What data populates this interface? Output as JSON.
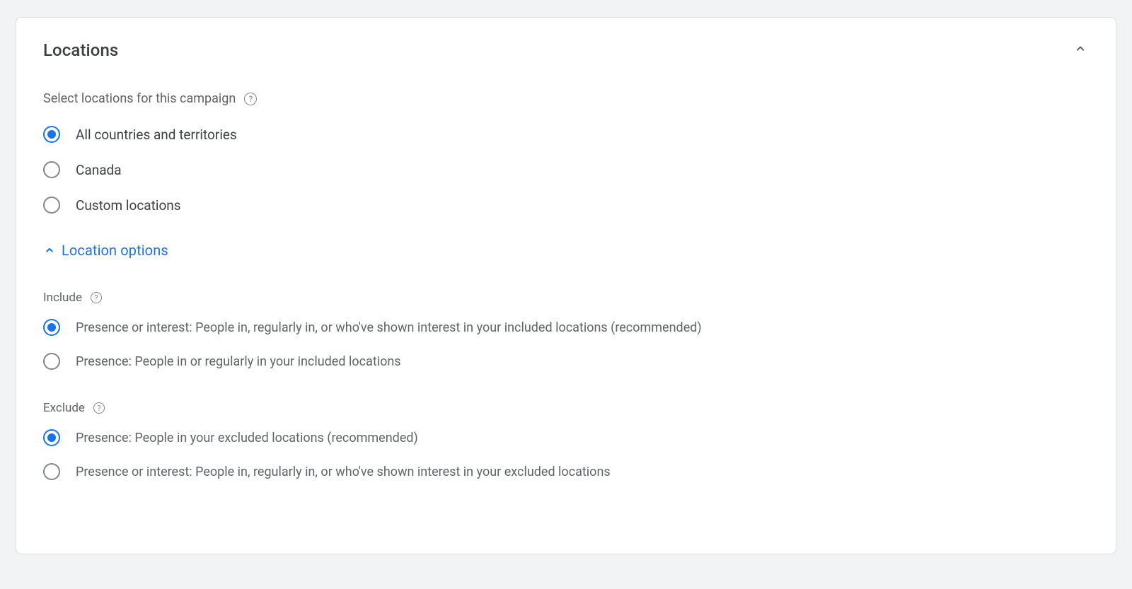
{
  "panel": {
    "title": "Locations",
    "subtitle": "Select locations for this campaign"
  },
  "locations": {
    "options": [
      {
        "label": "All countries and territories",
        "selected": true
      },
      {
        "label": "Canada",
        "selected": false
      },
      {
        "label": "Custom locations",
        "selected": false
      }
    ]
  },
  "expand": {
    "label": "Location options"
  },
  "include": {
    "label": "Include",
    "options": [
      {
        "label": "Presence or interest: People in, regularly in, or who've shown interest in your included locations (recommended)",
        "selected": true
      },
      {
        "label": "Presence: People in or regularly in your included locations",
        "selected": false
      }
    ]
  },
  "exclude": {
    "label": "Exclude",
    "options": [
      {
        "label": "Presence: People in your excluded locations (recommended)",
        "selected": true
      },
      {
        "label": "Presence or interest: People in, regularly in, or who've shown interest in your excluded locations",
        "selected": false
      }
    ]
  }
}
